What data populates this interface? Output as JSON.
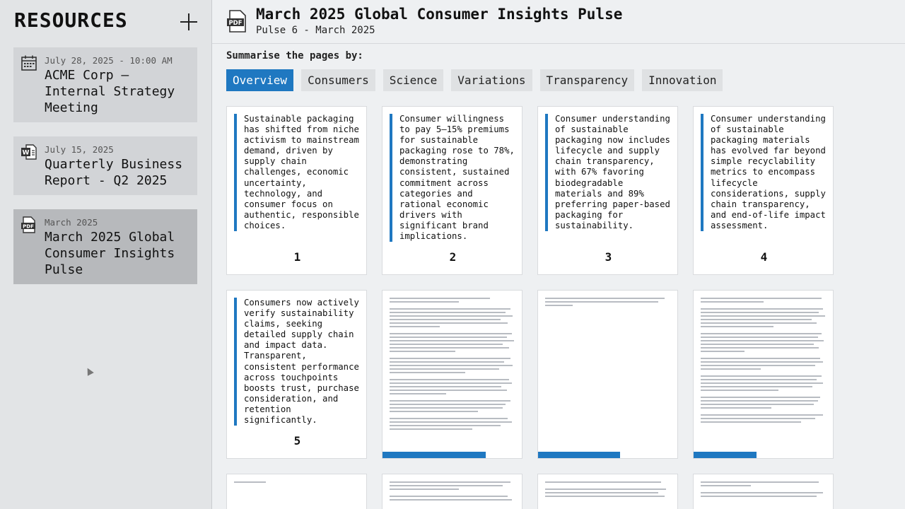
{
  "sidebar": {
    "title": "RESOURCES",
    "resources": [
      {
        "icon": "calendar-icon",
        "date": "July 28, 2025 - 10:00 AM",
        "title": "ACME Corp – Internal Strategy Meeting"
      },
      {
        "icon": "word-doc-icon",
        "date": "July 15, 2025",
        "title": "Quarterly Business Report - Q2 2025"
      },
      {
        "icon": "pdf-icon",
        "date": "March 2025",
        "title": "March 2025 Global Consumer Insights Pulse"
      }
    ]
  },
  "header": {
    "icon": "pdf-icon",
    "title": "March 2025 Global Consumer Insights Pulse",
    "subtitle": "Pulse 6 - March 2025"
  },
  "summarise": {
    "label": "Summarise the pages by:",
    "tabs": [
      "Overview",
      "Consumers",
      "Science",
      "Variations",
      "Transparency",
      "Innovation"
    ],
    "active_tab": "Overview"
  },
  "pages": [
    {
      "number": "1",
      "text": "Sustainable packaging has shifted from niche activism to mainstream demand, driven by supply chain challenges, economic uncertainty, technology, and consumer focus on authentic, responsible choices."
    },
    {
      "number": "2",
      "text": "Consumer willingness to pay 5–15% premiums for sustainable packaging rose to 78%, demonstrating consistent, sustained commitment across categories and rational economic drivers with significant brand implications."
    },
    {
      "number": "3",
      "text": "Consumer understanding of sustainable packaging now includes lifecycle and supply chain transparency, with 67% favoring biodegradable materials and 89% preferring paper-based packaging for sustainability."
    },
    {
      "number": "4",
      "text": "Consumer understanding of sustainable packaging materials has evolved far beyond simple recyclability metrics to encompass lifecycle considerations, supply chain transparency, and end-of-life impact assessment."
    },
    {
      "number": "5",
      "text": "Consumers now actively verify sustainability claims, seeking detailed supply chain and impact data. Transparent, consistent performance across touchpoints boosts trust, purchase consideration, and retention significantly."
    }
  ],
  "loading_pages": [
    {
      "progress": 0.74
    },
    {
      "progress": 0.59
    },
    {
      "progress": 0.45
    }
  ],
  "colors": {
    "accent": "#1f78c1"
  }
}
